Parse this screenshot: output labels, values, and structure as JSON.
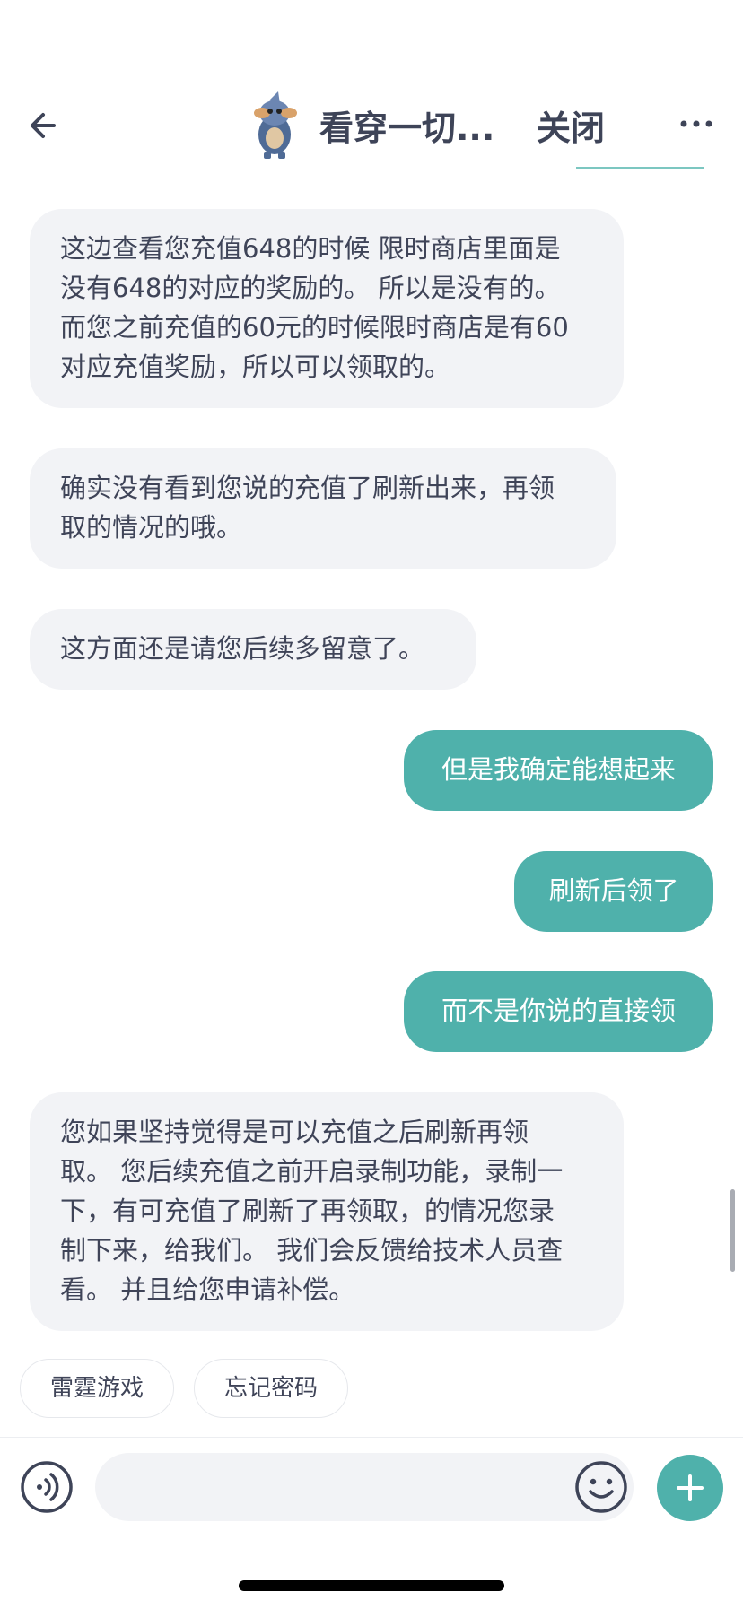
{
  "header": {
    "title": "看穿一切...",
    "close_label": "关闭",
    "icons": {
      "back": "arrow-left-icon",
      "more": "ellipsis-icon"
    }
  },
  "messages": [
    {
      "from": "agent",
      "lines": [
        "这边查看您充值648的时候 限时商店里面是",
        "没有648的对应的奖励的。 所以是没有的。",
        "而您之前充值的60元的时候限时商店是有60",
        "对应充值奖励，所以可以领取的。"
      ]
    },
    {
      "from": "agent",
      "lines": [
        "确实没有看到您说的充值了刷新出来，再领",
        "取的情况的哦。"
      ]
    },
    {
      "from": "agent",
      "lines": [
        "这方面还是请您后续多留意了。"
      ]
    },
    {
      "from": "user",
      "text": "但是我确定能想起来"
    },
    {
      "from": "user",
      "text": "刷新后领了"
    },
    {
      "from": "user",
      "text": "而不是你说的直接领"
    },
    {
      "from": "agent",
      "lines": [
        "您如果坚持觉得是可以充值之后刷新再领",
        "取。 您后续充值之前开启录制功能，录制一",
        "下，有可充值了刷新了再领取，的情况您录",
        "制下来，给我们。 我们会反馈给技术人员查",
        "看。 并且给您申请补偿。"
      ]
    }
  ],
  "quick_replies": [
    "雷霆游戏",
    "忘记密码"
  ],
  "input_bar": {
    "placeholder": "",
    "icons": {
      "voice": "voice-icon",
      "emoji": "emoji-icon",
      "add": "plus-icon"
    }
  },
  "colors": {
    "accent": "#4fb1ab",
    "agent_bubble": "#f2f3f6",
    "text": "#3f4458"
  }
}
